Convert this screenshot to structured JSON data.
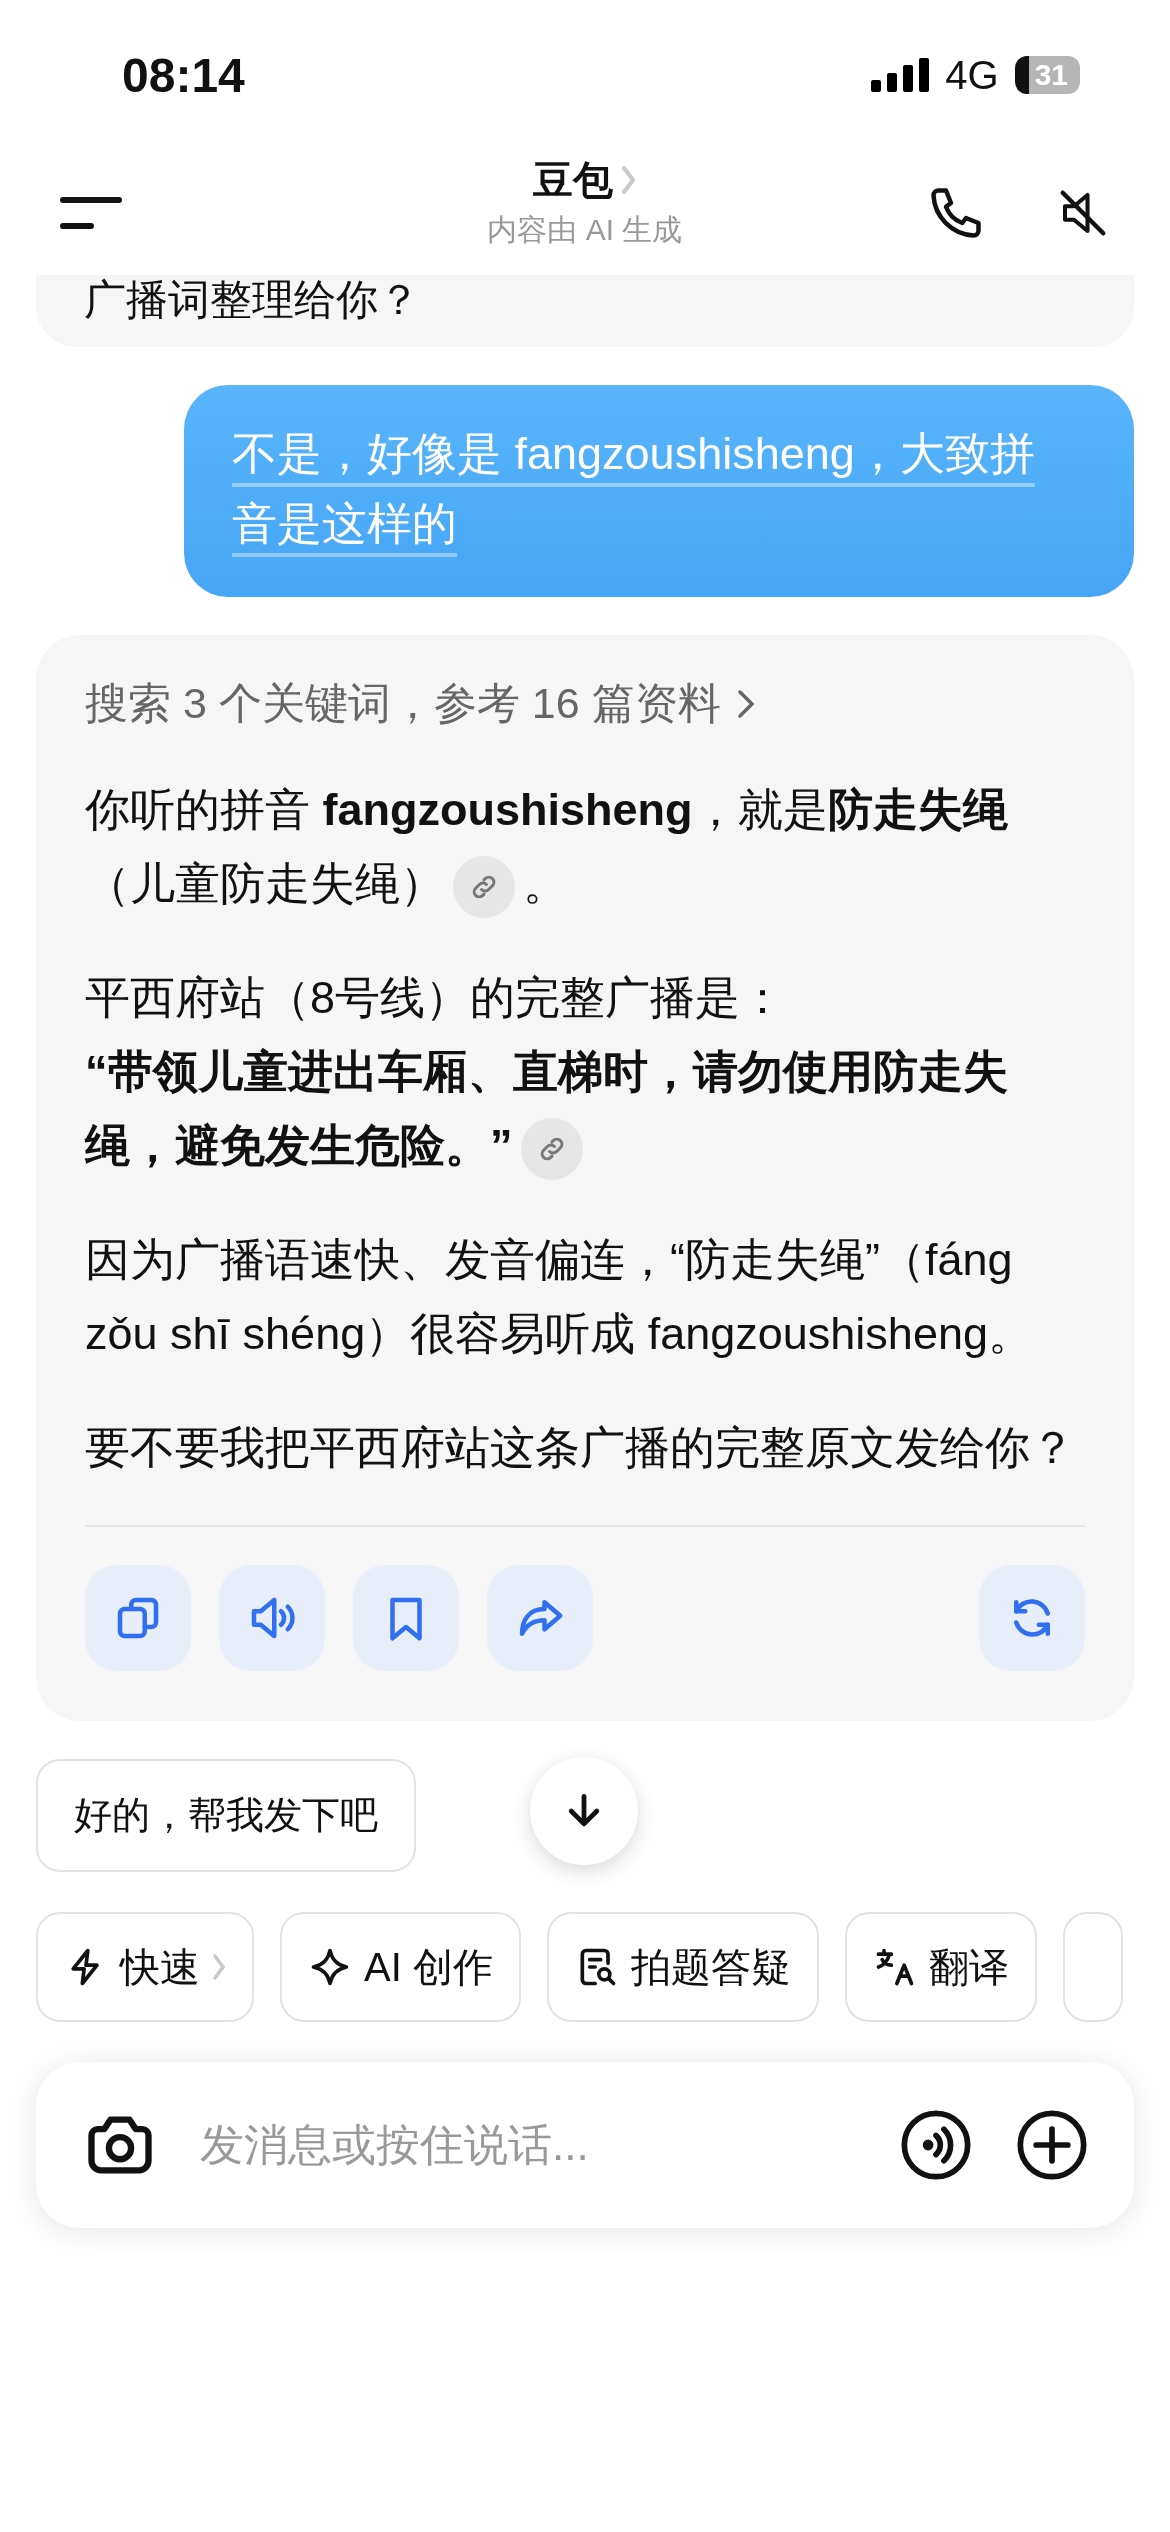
{
  "status_bar": {
    "time": "08:14",
    "network": "4G",
    "battery": "31"
  },
  "header": {
    "title": "豆包",
    "subtitle": "内容由 AI 生成"
  },
  "previous_message": {
    "text": "广播词整理给你？"
  },
  "user_message": {
    "text": "不是，好像是 fangzoushisheng，大致拼音是这样的"
  },
  "answer": {
    "search_summary": "搜索 3 个关键词，参考 16 篇资料",
    "paragraphs": [
      {
        "text": "你听的拼音 **fangzoushisheng**，就是**防走失绳**（儿童防走失绳）",
        "link": true,
        "tail": "。"
      },
      {
        "text": "平西府站（8号线）的完整广播是：\n**“带领儿童进出车厢、直梯时，请勿使用防走失绳，避免发生危险。”**",
        "link": true
      },
      {
        "text": "因为广播语速快、发音偏连，“防走失绳”（fáng zǒu shī shéng）很容易听成 fangzoushisheng。",
        "link": false
      },
      {
        "text": "要不要我把平西府站这条广播的完整原文发给你？",
        "link": false
      }
    ],
    "actions": [
      {
        "kind": "copy"
      },
      {
        "kind": "speak"
      },
      {
        "kind": "bookmark"
      },
      {
        "kind": "share"
      },
      {
        "kind": "regenerate"
      }
    ]
  },
  "suggestion": {
    "label": "好的，帮我发下吧"
  },
  "chips": [
    {
      "label": "快速",
      "kind": "bolt",
      "chevron": true
    },
    {
      "label": "AI 创作",
      "kind": "sparkle",
      "chevron": false
    },
    {
      "label": "拍题答疑",
      "kind": "scan",
      "chevron": false
    },
    {
      "label": "翻译",
      "kind": "translate",
      "chevron": false
    }
  ],
  "input": {
    "placeholder": "发消息或按住说话..."
  }
}
